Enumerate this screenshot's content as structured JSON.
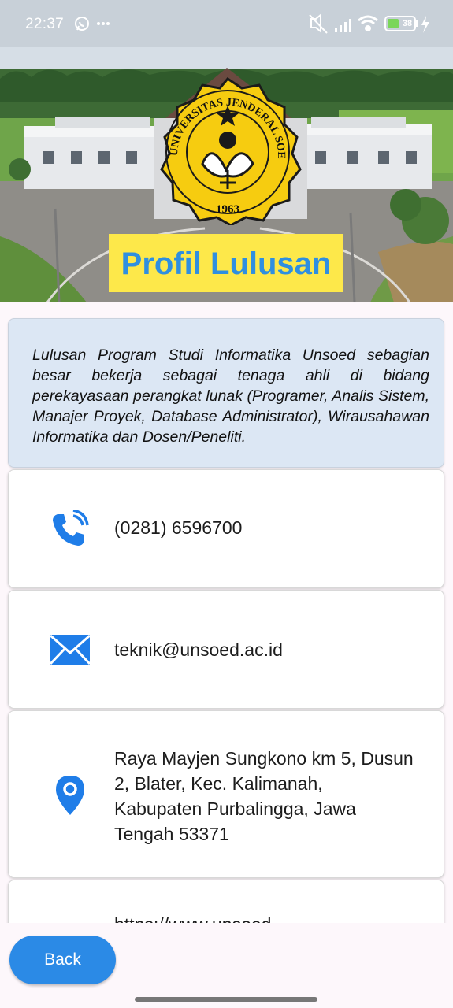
{
  "status_bar": {
    "time": "22:37",
    "battery": "38",
    "left_icons": [
      "whatsapp-icon",
      "more-icon"
    ],
    "right_icons": [
      "mute-icon",
      "signal-icon",
      "wifi-icon",
      "battery-icon",
      "charging-icon"
    ]
  },
  "header": {
    "title": "Profil Lulusan",
    "logo": {
      "arc_text": "UNIVERSITAS JENDERAL SOEDIRMAN",
      "year": "1963"
    }
  },
  "description": "Lulusan Program Studi Informatika Unsoed sebagian besar bekerja sebagai tenaga ahli di bidang perekayasaan perangkat lunak (Programer, Analis Sistem, Manajer Proyek, Database Administrator), Wirausahawan Informatika dan Dosen/Peneliti.",
  "contacts": {
    "phone": "(0281) 6596700",
    "email": "teknik@unsoed.ac.id",
    "address": "Raya Mayjen Sungkono km 5, Dusun 2, Blater, Kec. Kalimanah, Kabupaten Purbalingga, Jawa Tengah 53371",
    "website_partial": "https://www.unsoed..."
  },
  "colors": {
    "accent": "#2b8ae6",
    "title_bg": "#fde84a",
    "title_text": "#2f8fe0",
    "desc_bg": "#dce7f4"
  },
  "back_button": "Back"
}
